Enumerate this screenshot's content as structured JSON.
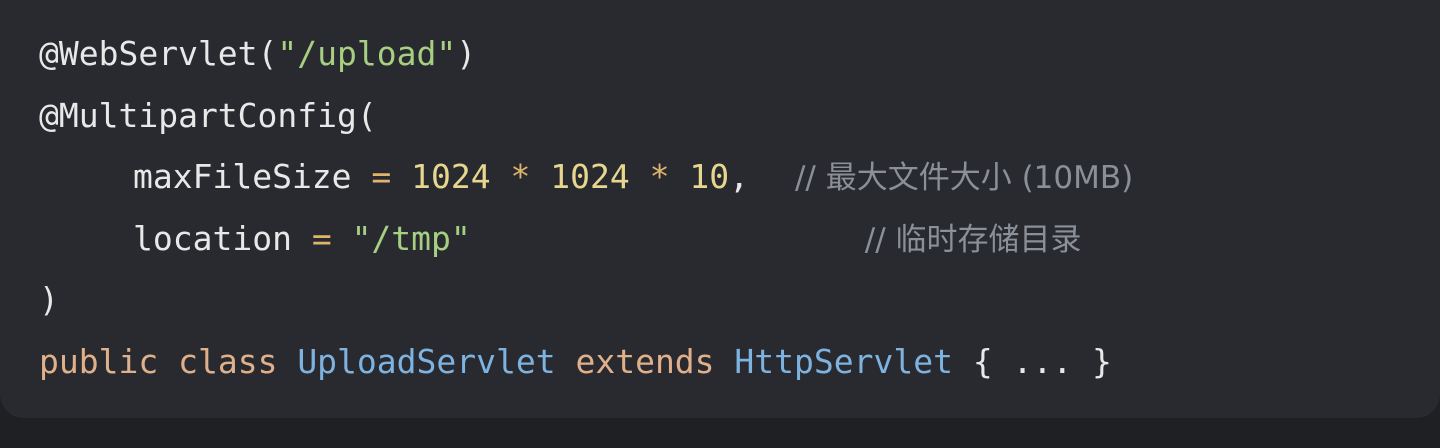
{
  "code": {
    "line1": {
      "annotation": "@WebServlet(",
      "string": "\"/upload\"",
      "close": ")"
    },
    "line2": {
      "annotation": "@MultipartConfig("
    },
    "line3": {
      "name": "maxFileSize",
      "eq": " = ",
      "num1": "1024",
      "mul1": " * ",
      "num2": "1024",
      "mul2": " * ",
      "num3": "10",
      "comma": ",",
      "comment": "// 最大文件大小 (10MB)"
    },
    "line4": {
      "name": "location",
      "eq": " = ",
      "string": "\"/tmp\"",
      "comment": "// 临时存储目录"
    },
    "line5": {
      "close": ")"
    },
    "line6": {
      "kw_public": "public",
      "kw_class": "class",
      "class_name": "UploadServlet",
      "kw_extends": "extends",
      "parent_name": "HttpServlet",
      "body": "{ ... }"
    }
  },
  "colors": {
    "background": "#282a30",
    "string": "#a6cf82",
    "number": "#e6d68e",
    "keyword": "#e0b08a",
    "type": "#7eb3e0",
    "comment": "#8a8f98"
  }
}
